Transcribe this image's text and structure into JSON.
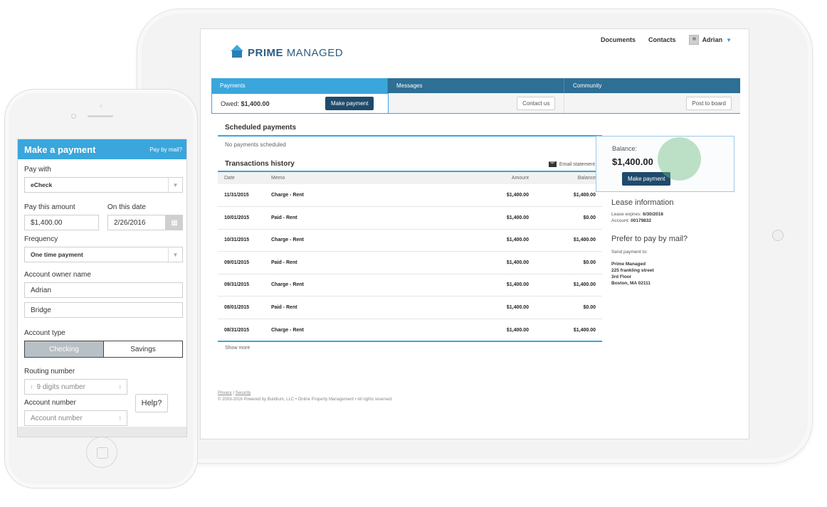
{
  "tablet": {
    "logo": {
      "bold": "PRIME",
      "rest": "MANAGED"
    },
    "topnav": {
      "documents": "Documents",
      "contacts": "Contacts",
      "user": "Adrian",
      "caret": "▼"
    },
    "tabs": [
      {
        "label": "Payments"
      },
      {
        "label": "Messages"
      },
      {
        "label": "Community"
      }
    ],
    "owed_label": "Owed:",
    "owed_value": "$1,400.00",
    "make_payment": "Make payment",
    "contact_us": "Contact us",
    "post_to_board": "Post to board",
    "scheduled_title": "Scheduled payments",
    "no_payments": "No payments scheduled",
    "tx_title": "Transactions history",
    "email_statement": "Email statement",
    "tx_columns": [
      "Date",
      "Memo",
      "Amount",
      "Balance"
    ],
    "transactions": [
      {
        "date": "11/31/2015",
        "memo": "Charge - Rent",
        "amount": "$1,400.00",
        "balance": "$1,400.00"
      },
      {
        "date": "10/01/2015",
        "memo": "Paid - Rent",
        "amount": "$1,400.00",
        "balance": "$0.00"
      },
      {
        "date": "10/31/2015",
        "memo": "Charge - Rent",
        "amount": "$1,400.00",
        "balance": "$1,400.00"
      },
      {
        "date": "09/01/2015",
        "memo": "Paid - Rent",
        "amount": "$1,400.00",
        "balance": "$0.00"
      },
      {
        "date": "09/31/2015",
        "memo": "Charge - Rent",
        "amount": "$1,400.00",
        "balance": "$1,400.00"
      },
      {
        "date": "08/01/2015",
        "memo": "Paid - Rent",
        "amount": "$1,400.00",
        "balance": "$0.00"
      },
      {
        "date": "08/31/2015",
        "memo": "Charge - Rent",
        "amount": "$1,400.00",
        "balance": "$1,400.00"
      }
    ],
    "show_more": "Show more",
    "footer": {
      "privacy": "Privacy",
      "sep": " | ",
      "security": "Security",
      "copyright": "© 2003-2016 Powered by Buildium, LLC • Online Property Management • All rights reserved."
    },
    "sidebar": {
      "balance_label": "Balance:",
      "balance_value": "$1,400.00",
      "make_payment": "Make payment",
      "lease_title": "Lease information",
      "lease_expires_label": "Lease expires:",
      "lease_expires_value": "6/30/2016",
      "account_label": "Account:",
      "account_value": "00179832",
      "mail_title": "Prefer to pay by mail?",
      "send_to": "Send payment to:",
      "address": [
        "Prime Managed",
        "225 frankling street",
        "3rd Floor",
        "Boston, MA 02111"
      ]
    }
  },
  "phone": {
    "title": "Make a payment",
    "pay_by_mail": "Pay by mail?",
    "pay_with_label": "Pay with",
    "pay_with_value": "eCheck",
    "amount_label": "Pay this amount",
    "amount_value": "$1,400.00",
    "date_label": "On this date",
    "date_value": "2/26/2016",
    "frequency_label": "Frequency",
    "frequency_value": "One time payment",
    "owner_label": "Account owner name",
    "first_name": "Adrian",
    "last_name": "Bridge",
    "account_type_label": "Account type",
    "checking": "Checking",
    "savings": "Savings",
    "routing_label": "Routing number",
    "routing_placeholder": "9 digits number",
    "account_number_label": "Account number",
    "account_number_placeholder": "Account number",
    "help": "Help?"
  },
  "colors": {
    "accent": "#3aa6dc",
    "tab_dark": "#2e6f95",
    "button_dark": "#1f4a6b",
    "highlight": "#6ebe82"
  }
}
